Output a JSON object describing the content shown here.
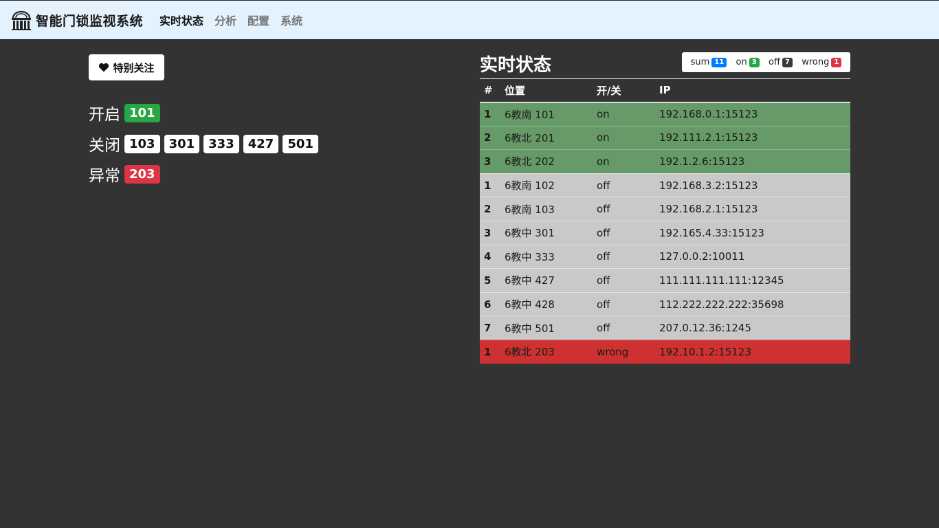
{
  "navbar": {
    "brand": "智能门锁监视系统",
    "items": [
      {
        "label": "实时状态",
        "active": true
      },
      {
        "label": "分析",
        "active": false
      },
      {
        "label": "配置",
        "active": false
      },
      {
        "label": "系统",
        "active": false
      }
    ]
  },
  "left": {
    "favorite_button": "特别关注",
    "groups": {
      "open": {
        "label": "开启",
        "rooms": [
          "101"
        ]
      },
      "closed": {
        "label": "关闭",
        "rooms": [
          "103",
          "301",
          "333",
          "427",
          "501"
        ]
      },
      "error": {
        "label": "异常",
        "rooms": [
          "203"
        ]
      }
    }
  },
  "right": {
    "title": "实时状态",
    "summary": [
      {
        "label": "sum",
        "count": "11"
      },
      {
        "label": "on",
        "count": "3"
      },
      {
        "label": "off",
        "count": "7"
      },
      {
        "label": "wrong",
        "count": "1"
      }
    ],
    "table": {
      "headers": [
        "#",
        "位置",
        "开/关",
        "IP"
      ],
      "rows": [
        {
          "num": "1",
          "location": "6教南 101",
          "state": "on",
          "ip": "192.168.0.1:15123"
        },
        {
          "num": "2",
          "location": "6教北 201",
          "state": "on",
          "ip": "192.111.2.1:15123"
        },
        {
          "num": "3",
          "location": "6教北 202",
          "state": "on",
          "ip": "192.1.2.6:15123"
        },
        {
          "num": "1",
          "location": "6教南 102",
          "state": "off",
          "ip": "192.168.3.2:15123"
        },
        {
          "num": "2",
          "location": "6教南 103",
          "state": "off",
          "ip": "192.168.2.1:15123"
        },
        {
          "num": "3",
          "location": "6教中 301",
          "state": "off",
          "ip": "192.165.4.33:15123"
        },
        {
          "num": "4",
          "location": "6教中 333",
          "state": "off",
          "ip": "127.0.0.2:10011"
        },
        {
          "num": "5",
          "location": "6教中 427",
          "state": "off",
          "ip": "111.111.111.111:12345"
        },
        {
          "num": "6",
          "location": "6教中 428",
          "state": "off",
          "ip": "112.222.222.222:35698"
        },
        {
          "num": "7",
          "location": "6教中 501",
          "state": "off",
          "ip": "207.0.12.36:1245"
        },
        {
          "num": "1",
          "location": "6教北 203",
          "state": "wrong",
          "ip": "192.10.1.2:15123"
        }
      ]
    }
  },
  "colors": {
    "navbar_bg": "#e3f2fd",
    "page_bg": "#333333",
    "row_on": "#679a69",
    "row_off": "#c9c9c9",
    "row_wrong": "#cd3132"
  }
}
